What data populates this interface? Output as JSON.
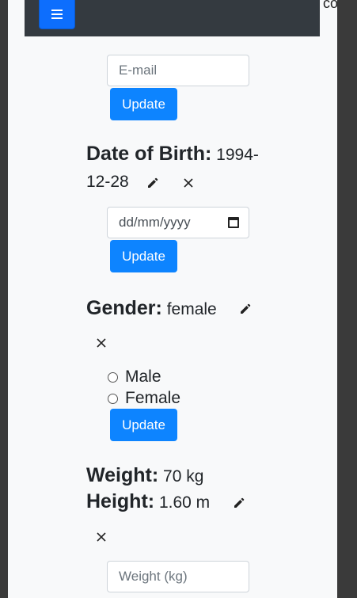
{
  "navbar": {
    "brand_fragment": "co"
  },
  "email": {
    "placeholder": "E-mail",
    "update_label": "Update"
  },
  "dob": {
    "label": "Date of Birth:",
    "value_line1": "1994-",
    "value_line2": "12-28",
    "placeholder": "dd/mm/yyyy",
    "update_label": "Update"
  },
  "gender": {
    "label": "Gender:",
    "value": "female",
    "options": [
      "Male",
      "Female"
    ],
    "update_label": "Update"
  },
  "weight": {
    "label": "Weight:",
    "value": "70 kg",
    "placeholder": "Weight (kg)"
  },
  "height": {
    "label": "Height:",
    "value": "1.60 m"
  },
  "colors": {
    "primary": "#0d84ff",
    "navbar": "#343a40",
    "page_bg": "#f8f9fa"
  }
}
